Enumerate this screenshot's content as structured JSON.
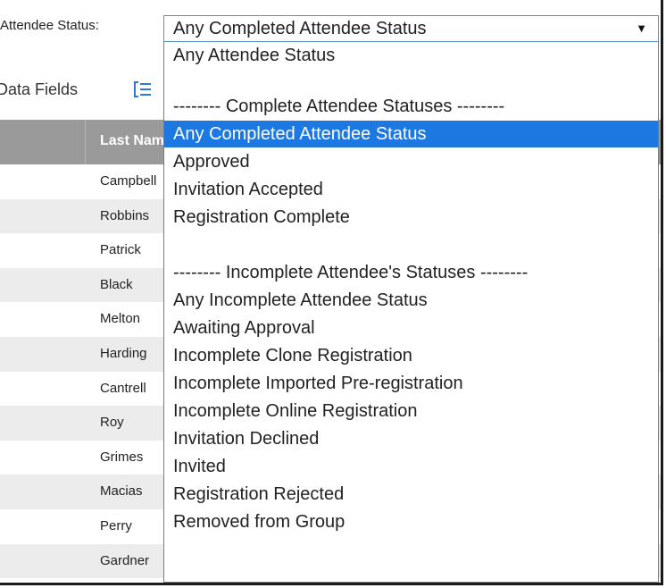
{
  "filter": {
    "label": "Attendee Status:",
    "selected_value": "Any Completed Attendee Status"
  },
  "toolbar": {
    "label": "Data Fields",
    "icon": "list-settings-icon"
  },
  "grid": {
    "columns": [
      "Last Name"
    ],
    "rows": [
      "Campbell",
      "Robbins",
      "Patrick",
      "Black",
      "Melton",
      "Harding",
      "Cantrell",
      "Roy",
      "Grimes",
      "Macias",
      "Perry",
      "Gardner"
    ]
  },
  "dropdown": {
    "options": [
      "Any Attendee Status",
      "",
      "-------- Complete Attendee Statuses --------",
      "Any Completed Attendee Status",
      "Approved",
      "Invitation Accepted",
      "Registration Complete",
      "",
      "-------- Incomplete Attendee's Statuses --------",
      "Any Incomplete Attendee Status",
      "Awaiting Approval",
      "Incomplete Clone Registration",
      "Incomplete Imported Pre-registration",
      "Incomplete Online Registration",
      "Invitation Declined",
      "Invited",
      "Registration Rejected",
      "Removed from Group"
    ],
    "selected_index": 3
  },
  "colors": {
    "selected_bg": "#1e78e1",
    "header_bg": "#9a9a9a",
    "alt_row_bg": "#ececec"
  }
}
